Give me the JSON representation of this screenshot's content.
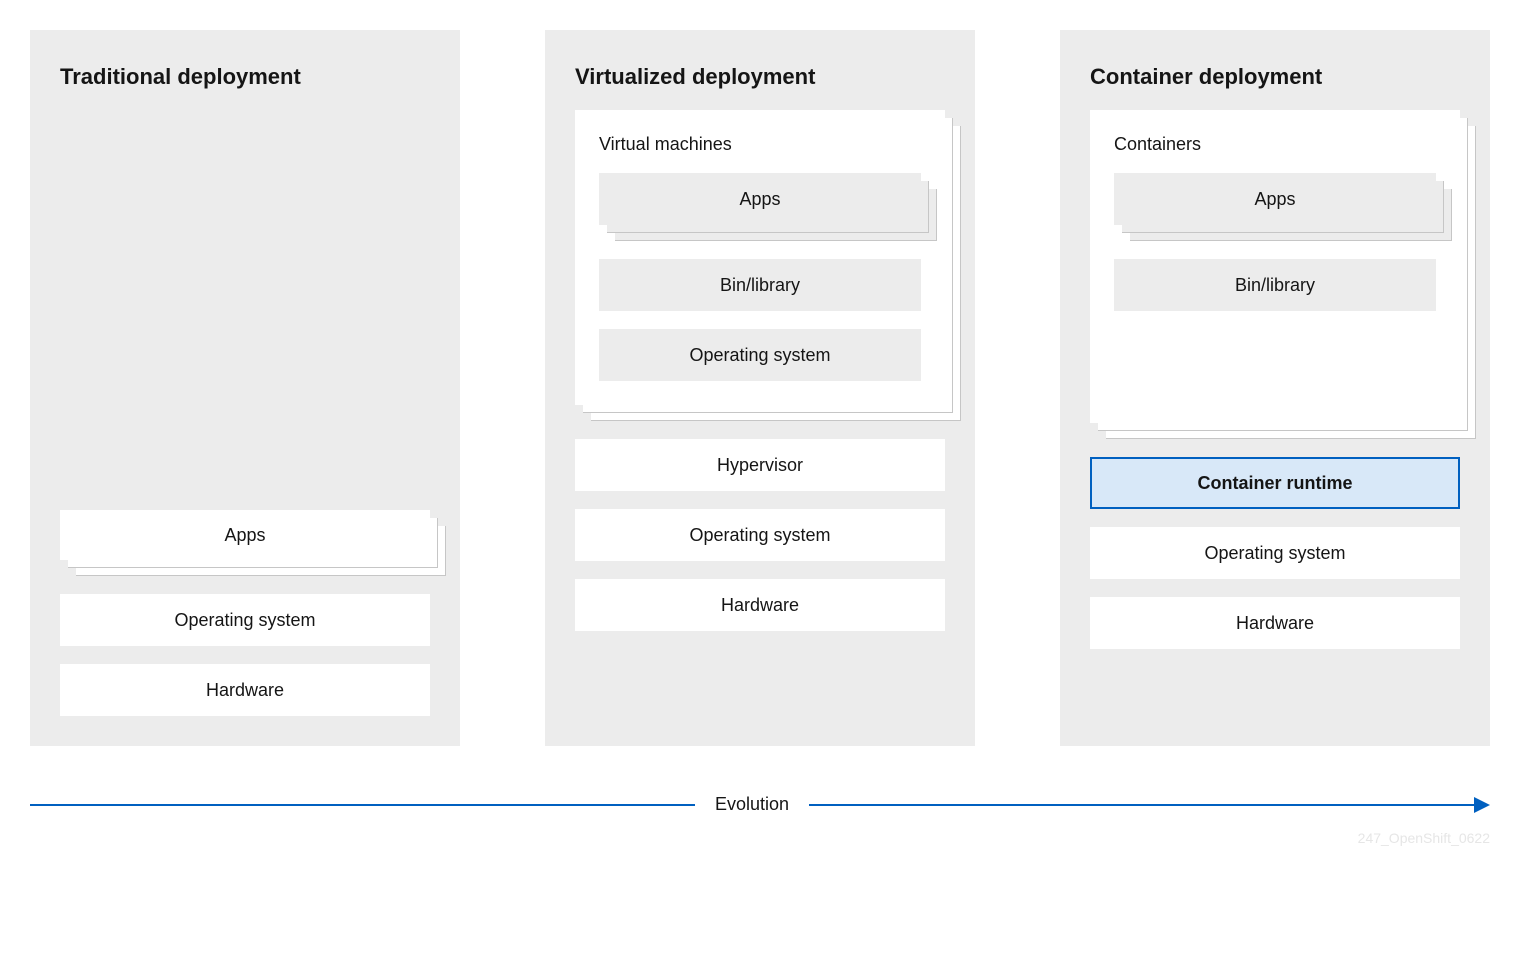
{
  "columns": {
    "traditional": {
      "title": "Traditional deployment",
      "apps": "Apps",
      "os": "Operating system",
      "hw": "Hardware"
    },
    "virtualized": {
      "title": "Virtualized deployment",
      "vm_title": "Virtual machines",
      "apps": "Apps",
      "bin": "Bin/library",
      "vm_os": "Operating system",
      "hypervisor": "Hypervisor",
      "os": "Operating system",
      "hw": "Hardware"
    },
    "container": {
      "title": "Container deployment",
      "cont_title": "Containers",
      "apps": "Apps",
      "bin": "Bin/library",
      "runtime": "Container runtime",
      "os": "Operating system",
      "hw": "Hardware"
    }
  },
  "evolution_label": "Evolution",
  "watermark": "247_OpenShift_0622",
  "colors": {
    "panel_bg": "#ececec",
    "highlight_bg": "#d8e8f8",
    "highlight_border": "#0060c0",
    "arrow": "#0060c0"
  }
}
